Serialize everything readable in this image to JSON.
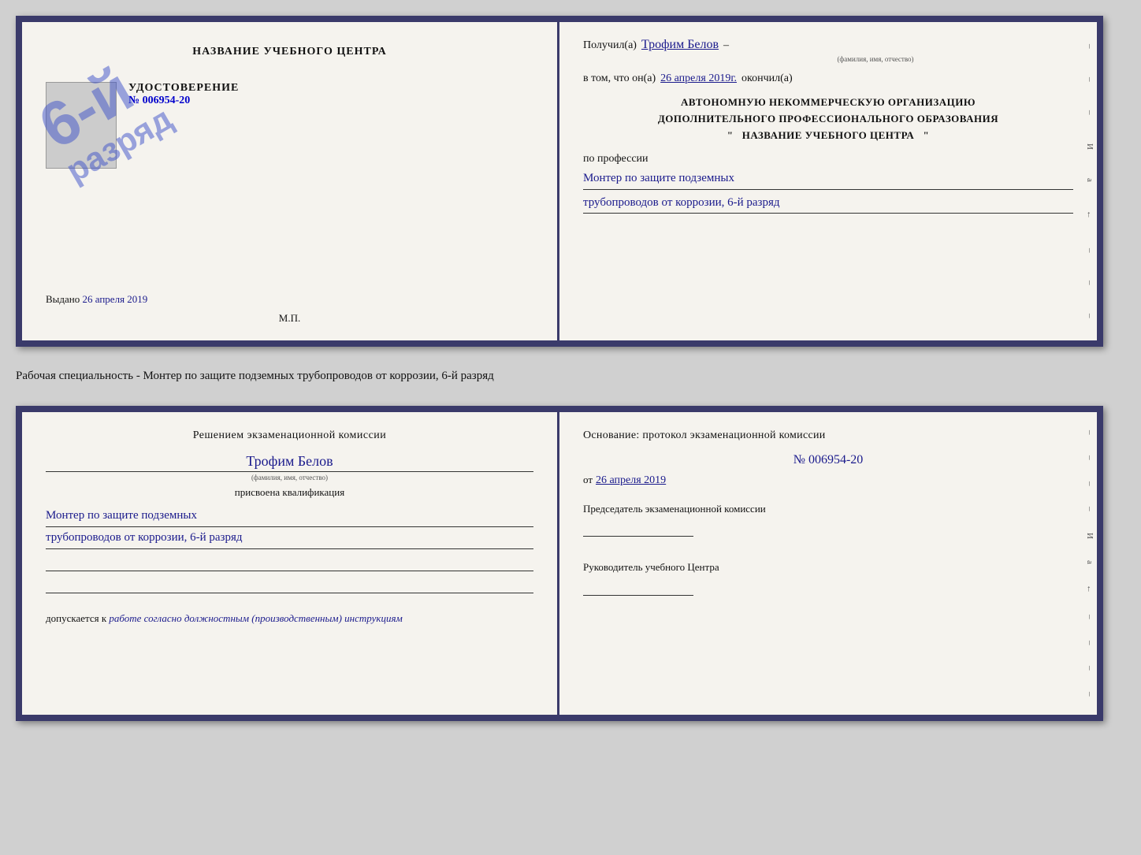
{
  "doc_top": {
    "left": {
      "title": "НАЗВАНИЕ УЧЕБНОГО ЦЕНТРА",
      "udost_label": "УДОСТОВЕРЕНИЕ",
      "udost_num": "№ 006954-20",
      "vydano_label": "Выдано",
      "vydano_date": "26 апреля 2019",
      "mp_label": "М.П.",
      "stamp_line1": "6-й",
      "stamp_line2": "разряд"
    },
    "right": {
      "poluchil_label": "Получил(а)",
      "fio_handwritten": "Трофим Белов",
      "fio_sublabel": "(фамилия, имя, отчество)",
      "dash1": "–",
      "vtom_label": "в том, что он(а)",
      "date_handwritten": "26 апреля 2019г.",
      "okochil_label": "окончил(а)",
      "org_line1": "АВТОНОМНУЮ НЕКОММЕРЧЕСКУЮ ОРГАНИЗАЦИЮ",
      "org_line2": "ДОПОЛНИТЕЛЬНОГО ПРОФЕССИОНАЛЬНОГО ОБРАЗОВАНИЯ",
      "org_quote_open": "\"",
      "org_name": "НАЗВАНИЕ УЧЕБНОГО ЦЕНТРА",
      "org_quote_close": "\"",
      "po_professii_label": "по профессии",
      "profession_line1": "Монтер по защите подземных",
      "profession_line2": "трубопроводов от коррозии, 6-й разряд",
      "right_chars": [
        "–",
        "–",
        "–",
        "И",
        "а",
        "←",
        "–",
        "–",
        "–"
      ]
    }
  },
  "middle_text": "Рабочая специальность - Монтер по защите подземных трубопроводов от коррозии, 6-й разряд",
  "doc_bottom": {
    "left": {
      "resheniem_label": "Решением экзаменационной комиссии",
      "fio_handwritten": "Трофим Белов",
      "fio_sublabel": "(фамилия, имя, отчество)",
      "prisvoena_label": "присвоена квалификация",
      "kvalif_line1": "Монтер по защите подземных",
      "kvalif_line2": "трубопроводов от коррозии, 6-й разряд",
      "blank_line1": "",
      "blank_line2": "",
      "dopuskaetsya_label": "допускается к",
      "dopuskaetsya_value": "работе согласно должностным (производственным) инструкциям"
    },
    "right": {
      "osnovanie_label": "Основание: протокол экзаменационной комиссии",
      "protocol_num": "№ 006954-20",
      "ot_label": "от",
      "ot_date_handwritten": "26 апреля 2019",
      "predsedatel_label": "Председатель экзаменационной комиссии",
      "rukovoditel_label": "Руководитель учебного Центра",
      "right_chars": [
        "–",
        "–",
        "–",
        "–",
        "И",
        "а",
        "←",
        "–",
        "–",
        "–",
        "–"
      ]
    }
  }
}
